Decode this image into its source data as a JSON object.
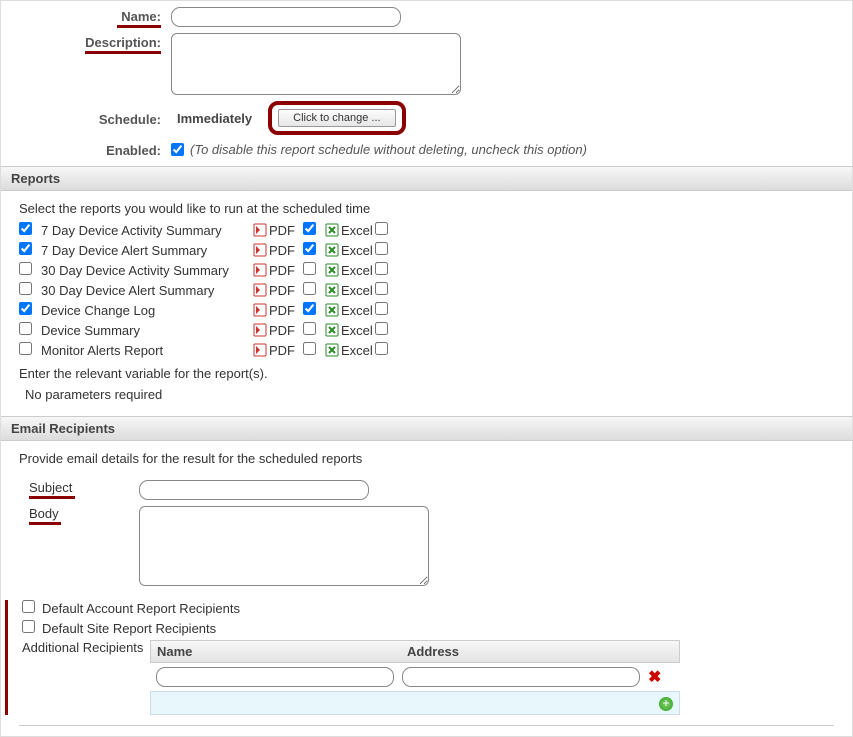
{
  "form": {
    "name_label": "Name:",
    "name_value": "",
    "desc_label": "Description:",
    "desc_value": "",
    "schedule_label": "Schedule:",
    "schedule_value": "Immediately",
    "schedule_change": "Click to change ...",
    "enabled_label": "Enabled:",
    "enabled_note": "(To disable this report schedule without deleting, uncheck this option)"
  },
  "reports": {
    "header": "Reports",
    "select_note": "Select the reports you would like to run at the scheduled time",
    "pdf_label": "PDF",
    "excel_label": "Excel",
    "items": [
      {
        "name": "7 Day Device Activity Summary",
        "checked": true,
        "pdf": true,
        "excel": false
      },
      {
        "name": "7 Day Device Alert Summary",
        "checked": true,
        "pdf": true,
        "excel": false
      },
      {
        "name": "30 Day Device Activity Summary",
        "checked": false,
        "pdf": false,
        "excel": false
      },
      {
        "name": "30 Day Device Alert Summary",
        "checked": false,
        "pdf": false,
        "excel": false
      },
      {
        "name": "Device Change Log",
        "checked": true,
        "pdf": true,
        "excel": false
      },
      {
        "name": "Device Summary",
        "checked": false,
        "pdf": false,
        "excel": false
      },
      {
        "name": "Monitor Alerts Report",
        "checked": false,
        "pdf": false,
        "excel": false
      }
    ],
    "param_note": "Enter the relevant variable for the report(s).",
    "param_none": "No parameters required"
  },
  "email": {
    "header": "Email Recipients",
    "provide_note": "Provide email details for the result for the scheduled reports",
    "subject_label": "Subject",
    "subject_value": "",
    "body_label": "Body",
    "body_value": "",
    "default_account": "Default Account Report Recipients",
    "default_site": "Default Site Report Recipients",
    "additional_label": "Additional Recipients",
    "col_name": "Name",
    "col_address": "Address",
    "rows": [
      {
        "name": "",
        "address": ""
      }
    ]
  }
}
